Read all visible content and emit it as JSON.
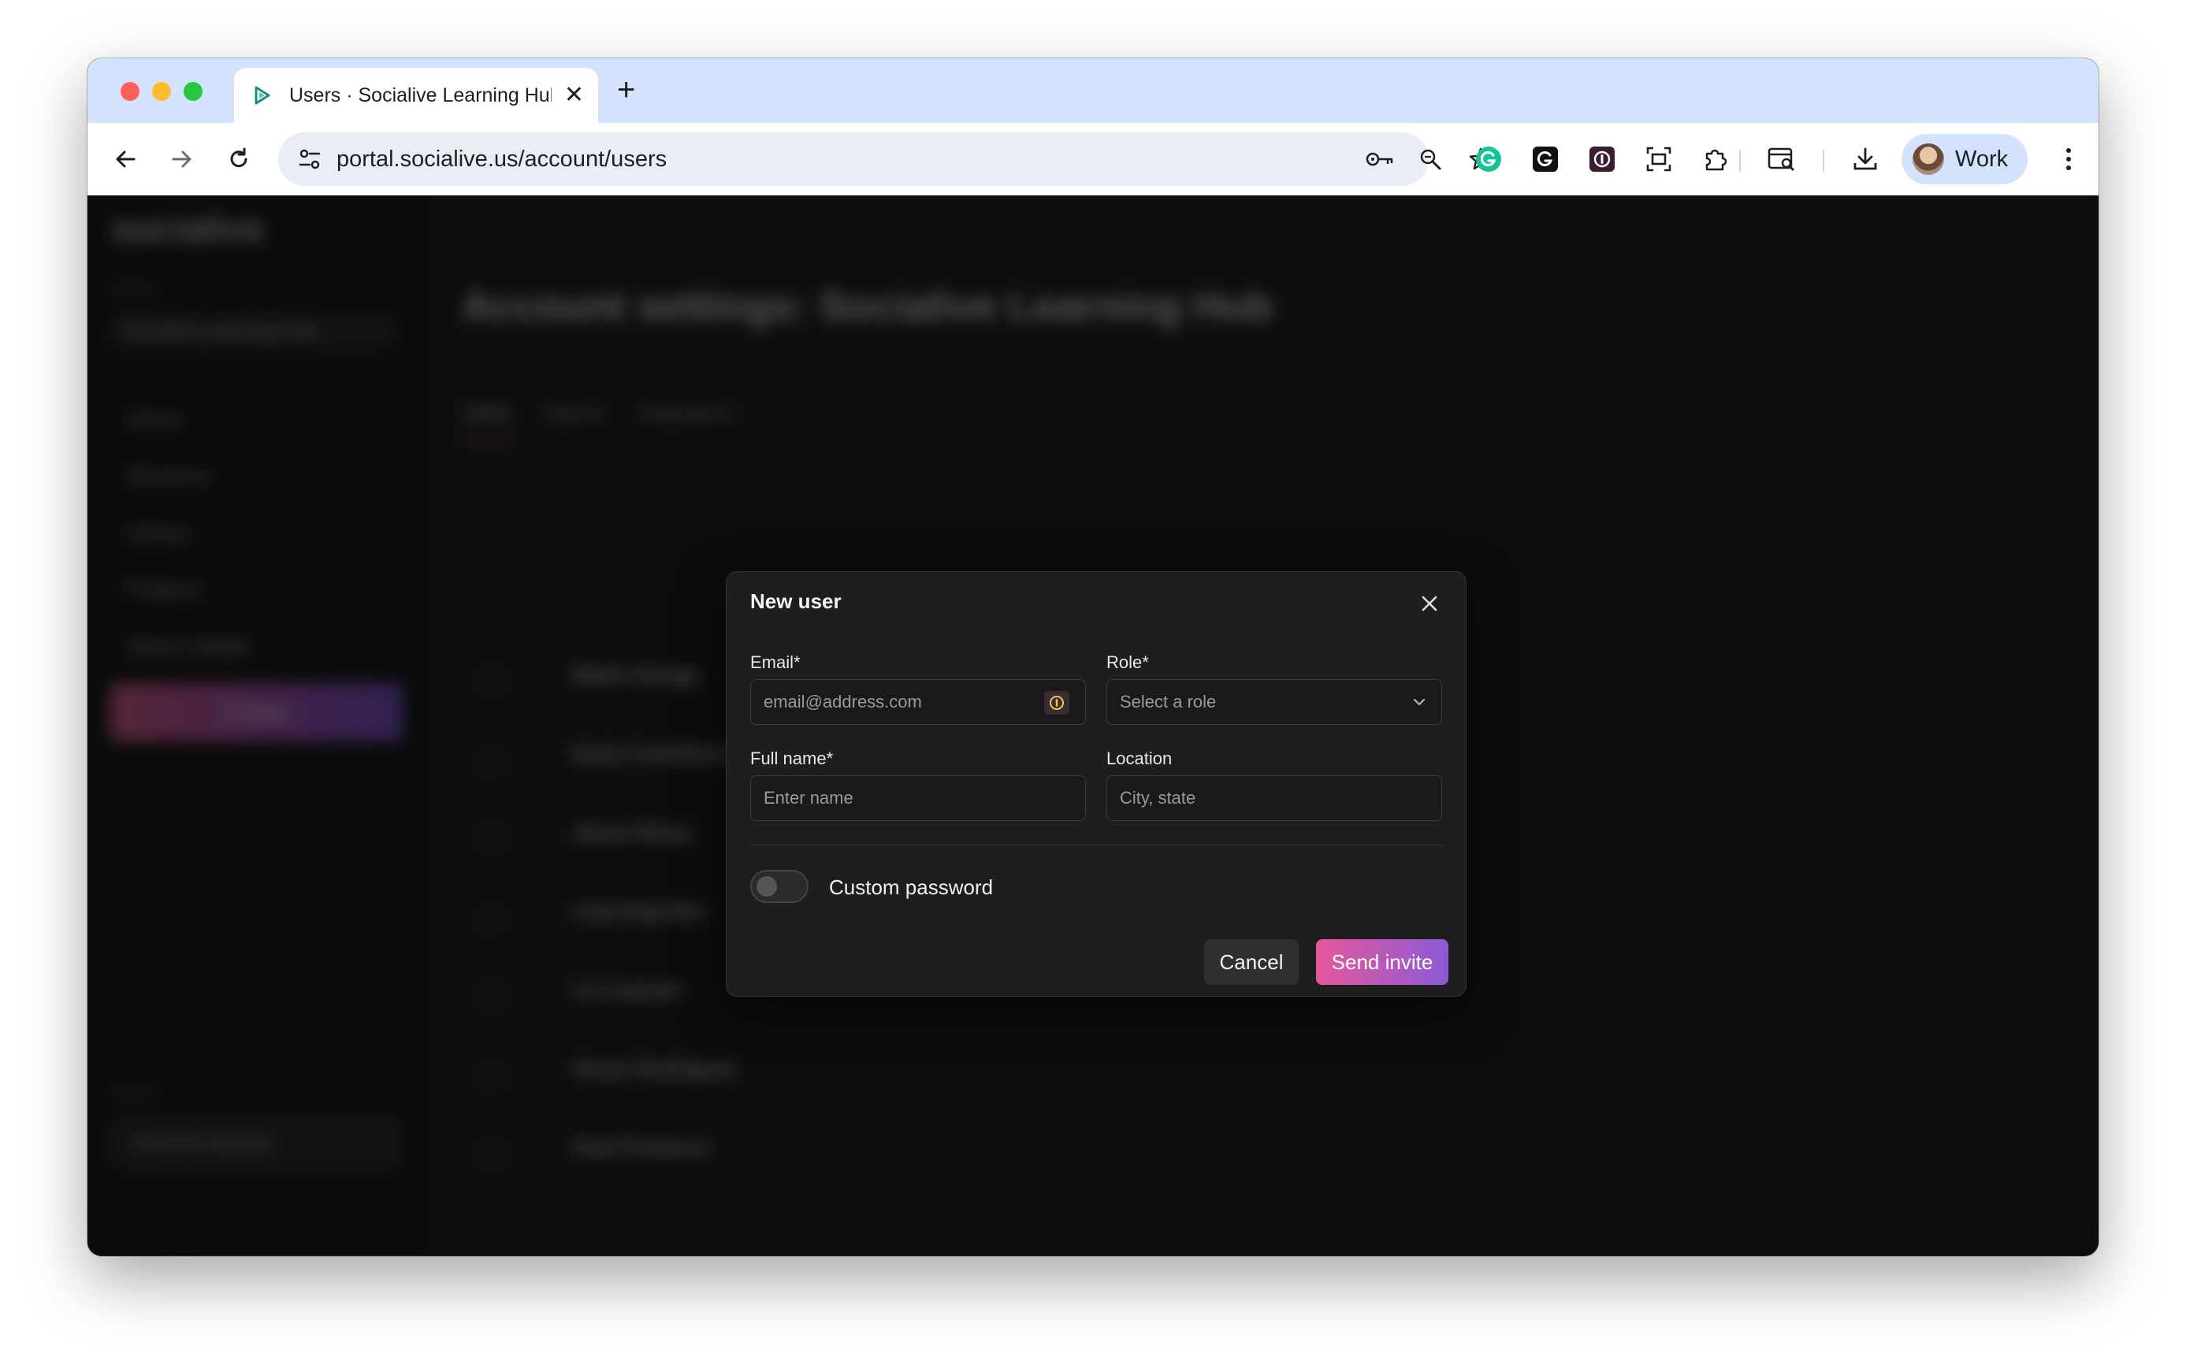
{
  "browser": {
    "tab_title": "Users · Socialive Learning Hub",
    "url": "portal.socialive.us/account/users",
    "profile_label": "Work"
  },
  "background": {
    "logo": "socialive",
    "space_label": "Space",
    "space_name": "Socialive Learning Hub",
    "nav": [
      "Home",
      "Sessions",
      "Library",
      "Projects",
      "Space details"
    ],
    "create_label": "Create",
    "admin_label": "Admin",
    "account_settings_label": "Account settings",
    "heading": "Account settings: Socialive Learning Hub",
    "tabs": [
      "Users",
      "Spaces",
      "Integrations"
    ],
    "rows": [
      {
        "name": "Baker Dunga",
        "sub": "",
        "c3": "",
        "c4": ""
      },
      {
        "name": "Early Contributor",
        "sub": "",
        "c3": "",
        "c4": ""
      },
      {
        "name": "Jason Rivas",
        "sub": "",
        "c3": "",
        "c4": ""
      },
      {
        "name": "Learning Hub",
        "sub": "",
        "c3": "",
        "c4": ""
      },
      {
        "name": "Liz Learner",
        "sub": "",
        "c3": "",
        "c4": ""
      },
      {
        "name": "Oscar Rodriguez",
        "sub": "",
        "c3": "",
        "c4": ""
      },
      {
        "name": "Paul Producer",
        "sub": "",
        "c3": "",
        "c4": ""
      }
    ]
  },
  "modal": {
    "title": "New user",
    "email_label": "Email*",
    "email_placeholder": "email@address.com",
    "role_label": "Role*",
    "role_placeholder": "Select a role",
    "fullname_label": "Full name*",
    "fullname_placeholder": "Enter name",
    "location_label": "Location",
    "location_placeholder": "City, state",
    "custom_password_label": "Custom password",
    "custom_password_enabled": false,
    "cancel_label": "Cancel",
    "send_label": "Send invite"
  },
  "colors": {
    "accent_start": "#e6579a",
    "accent_end": "#8b5bd8",
    "tab_strip": "#d3e3fd"
  }
}
